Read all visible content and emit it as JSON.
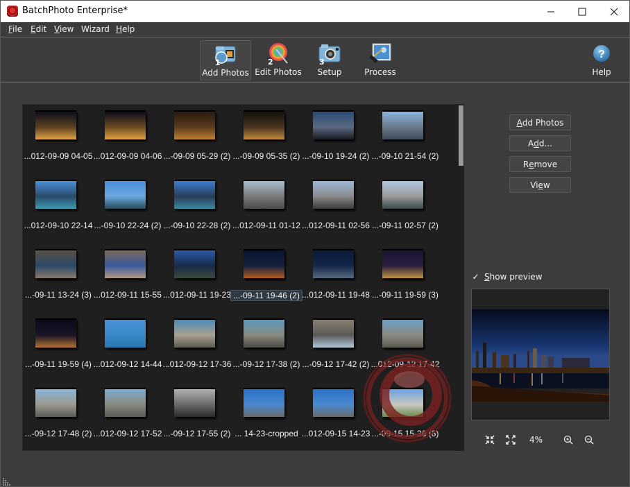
{
  "window": {
    "title": "BatchPhoto Enterprise*",
    "controls": {
      "minimize": "—",
      "maximize": "☐",
      "close": "✕"
    }
  },
  "menu": [
    {
      "label": "File",
      "mnemonic": "F",
      "rest": "ile"
    },
    {
      "label": "Edit",
      "mnemonic": "E",
      "rest": "dit"
    },
    {
      "label": "View",
      "mnemonic": "V",
      "rest": "iew"
    },
    {
      "label": "Wizard",
      "mnemonic": "",
      "rest": "Wizard"
    },
    {
      "label": "Help",
      "mnemonic": "H",
      "rest": "elp"
    }
  ],
  "toolbar": {
    "steps": [
      {
        "num": "1",
        "label": "Add Photos",
        "icon": "add-photos-icon",
        "active": true
      },
      {
        "num": "2",
        "label": "Edit Photos",
        "icon": "edit-photos-icon",
        "active": false
      },
      {
        "num": "3",
        "label": "Setup",
        "icon": "setup-camera-icon",
        "active": false
      },
      {
        "num": "",
        "label": "Process",
        "icon": "process-icon",
        "active": false
      }
    ],
    "help": {
      "label": "Help",
      "icon": "help-icon"
    }
  },
  "photos": [
    {
      "caption": "...012-09-09 04-05",
      "colors": [
        "#0b0d1a",
        "#5a4020",
        "#e0a040"
      ]
    },
    {
      "caption": "...012-09-09 04-06",
      "colors": [
        "#0b0d1a",
        "#6a4a22",
        "#e0a040"
      ]
    },
    {
      "caption": "...-09-09 05-29 (2)",
      "colors": [
        "#2a1a10",
        "#5a3a1c",
        "#c08030"
      ]
    },
    {
      "caption": "...-09-09 05-35 (2)",
      "colors": [
        "#15100c",
        "#4a3420",
        "#c08a3c"
      ]
    },
    {
      "caption": "...-09-10 19-24 (2)",
      "colors": [
        "#2a4a7a",
        "#5a6a80",
        "#1a1a22"
      ]
    },
    {
      "caption": "...-09-10 21-54 (2)",
      "colors": [
        "#8ab4e0",
        "#6a7a8a",
        "#3a4a5a"
      ]
    },
    {
      "caption": "...012-09-10 22-14",
      "colors": [
        "#4a90d8",
        "#2a4a6a",
        "#3a9ab0"
      ]
    },
    {
      "caption": "...-09-10 22-24 (2)",
      "colors": [
        "#4a8ed8",
        "#6aa8e0",
        "#2a4a5a"
      ]
    },
    {
      "caption": "...-09-10 22-28 (2)",
      "colors": [
        "#3a80d0",
        "#2a3a5a",
        "#3a8aa0"
      ]
    },
    {
      "caption": "...012-09-11 01-12",
      "colors": [
        "#a8bcd0",
        "#7a7a7a",
        "#4a4a4a"
      ]
    },
    {
      "caption": "...012-09-11 02-56",
      "colors": [
        "#9ab8d8",
        "#8a8a8a",
        "#3a3a3a"
      ]
    },
    {
      "caption": "...-09-11 02-57 (2)",
      "colors": [
        "#b0c8e0",
        "#9a9a9a",
        "#3a4a4a"
      ]
    },
    {
      "caption": "...-09-11 13-24 (3)",
      "colors": [
        "#5a5046",
        "#2a4a6a",
        "#8a7a6a"
      ]
    },
    {
      "caption": "...012-09-11 15-55",
      "colors": [
        "#7a6a58",
        "#3a5aa0",
        "#b09a80"
      ]
    },
    {
      "caption": "...012-09-11 19-23",
      "colors": [
        "#2a5aa8",
        "#1a2a4a",
        "#3a4a3a"
      ]
    },
    {
      "caption": "...-09-11 19-46 (2)",
      "colors": [
        "#0a1430",
        "#14223e",
        "#b05a20"
      ],
      "selected": true
    },
    {
      "caption": "...012-09-11 19-48",
      "colors": [
        "#0c1838",
        "#14264a",
        "#5a6a80"
      ]
    },
    {
      "caption": "...-09-11 19-59 (3)",
      "colors": [
        "#1a1430",
        "#2a2040",
        "#c09040"
      ]
    },
    {
      "caption": "...-09-11 19-59 (4)",
      "colors": [
        "#0a0a1a",
        "#1a1426",
        "#b07030"
      ]
    },
    {
      "caption": "...012-09-12 14-44",
      "colors": [
        "#4a90d8",
        "#3a8ac8",
        "#2a78b0"
      ]
    },
    {
      "caption": "...012-09-12 17-36",
      "colors": [
        "#4a8ab8",
        "#a8a090",
        "#5a5a50"
      ]
    },
    {
      "caption": "...-09-12 17-38 (2)",
      "colors": [
        "#5a9ac0",
        "#8a8a80",
        "#4a4a44"
      ]
    },
    {
      "caption": "...-09-12 17-42 (2)",
      "colors": [
        "#8a8070",
        "#5a5a58",
        "#b0c8d8"
      ]
    },
    {
      "caption": "...012-09-12 17-42",
      "colors": [
        "#6aa0c8",
        "#8a8a80",
        "#5a5a50"
      ]
    },
    {
      "caption": "...-09-12 17-48 (2)",
      "colors": [
        "#8ab4d8",
        "#9a9a90",
        "#5a5a58"
      ]
    },
    {
      "caption": "...012-09-12 17-52",
      "colors": [
        "#7aaad0",
        "#8a8a80",
        "#5a5a58"
      ]
    },
    {
      "caption": "...-09-12 17-55 (2)",
      "colors": [
        "#b0b0b0",
        "#6a6a6a",
        "#2a2a2a"
      ]
    },
    {
      "caption": "... 14-23-cropped",
      "colors": [
        "#2a70c8",
        "#4a8ad0",
        "#6a6a6a"
      ]
    },
    {
      "caption": "...012-09-15 14-23",
      "colors": [
        "#2a70c8",
        "#4a8ad0",
        "#6a6a6a"
      ]
    },
    {
      "caption": "...-09-15 15-36 (6)",
      "colors": [
        "#6aa0e0",
        "#c8c8c0",
        "#6a8a4a"
      ]
    }
  ],
  "actions": {
    "add_photos": {
      "pre": "",
      "mn": "A",
      "post": "dd Photos"
    },
    "add": {
      "pre": "A",
      "mn": "d",
      "post": "d..."
    },
    "remove": {
      "pre": "R",
      "mn": "e",
      "post": "move"
    },
    "view": {
      "pre": "Vi",
      "mn": "e",
      "post": "w"
    }
  },
  "preview": {
    "show_preview_label_mn": "S",
    "show_preview_label_rest": "how preview",
    "show_preview_checked": true,
    "check_glyph": "✓",
    "zoom_level": "4%",
    "tools": {
      "fit": "fit-to-window-icon",
      "actual": "actual-size-icon",
      "zoom_in": "zoom-in-icon",
      "zoom_out": "zoom-out-icon"
    }
  },
  "colors": {
    "background": "#3c3c3c",
    "grid_background": "#1f1f1f",
    "accent_red": "#8a1e1e",
    "selection": "#2e3a44"
  }
}
